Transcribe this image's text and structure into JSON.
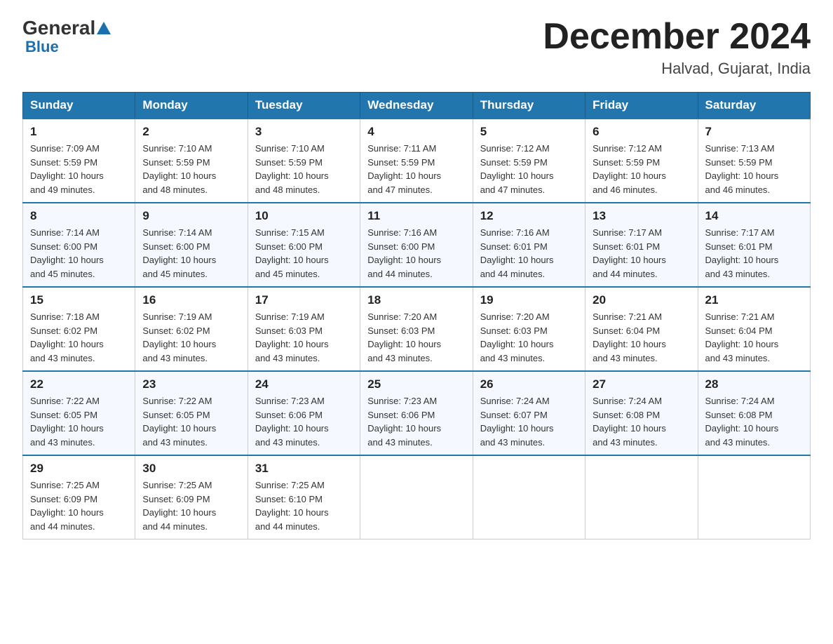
{
  "header": {
    "logo_general": "General",
    "logo_triangle": "▶",
    "logo_blue": "Blue",
    "month_title": "December 2024",
    "location": "Halvad, Gujarat, India"
  },
  "days_of_week": [
    "Sunday",
    "Monday",
    "Tuesday",
    "Wednesday",
    "Thursday",
    "Friday",
    "Saturday"
  ],
  "weeks": [
    [
      {
        "day": "1",
        "sunrise": "7:09 AM",
        "sunset": "5:59 PM",
        "daylight": "10 hours and 49 minutes."
      },
      {
        "day": "2",
        "sunrise": "7:10 AM",
        "sunset": "5:59 PM",
        "daylight": "10 hours and 48 minutes."
      },
      {
        "day": "3",
        "sunrise": "7:10 AM",
        "sunset": "5:59 PM",
        "daylight": "10 hours and 48 minutes."
      },
      {
        "day": "4",
        "sunrise": "7:11 AM",
        "sunset": "5:59 PM",
        "daylight": "10 hours and 47 minutes."
      },
      {
        "day": "5",
        "sunrise": "7:12 AM",
        "sunset": "5:59 PM",
        "daylight": "10 hours and 47 minutes."
      },
      {
        "day": "6",
        "sunrise": "7:12 AM",
        "sunset": "5:59 PM",
        "daylight": "10 hours and 46 minutes."
      },
      {
        "day": "7",
        "sunrise": "7:13 AM",
        "sunset": "5:59 PM",
        "daylight": "10 hours and 46 minutes."
      }
    ],
    [
      {
        "day": "8",
        "sunrise": "7:14 AM",
        "sunset": "6:00 PM",
        "daylight": "10 hours and 45 minutes."
      },
      {
        "day": "9",
        "sunrise": "7:14 AM",
        "sunset": "6:00 PM",
        "daylight": "10 hours and 45 minutes."
      },
      {
        "day": "10",
        "sunrise": "7:15 AM",
        "sunset": "6:00 PM",
        "daylight": "10 hours and 45 minutes."
      },
      {
        "day": "11",
        "sunrise": "7:16 AM",
        "sunset": "6:00 PM",
        "daylight": "10 hours and 44 minutes."
      },
      {
        "day": "12",
        "sunrise": "7:16 AM",
        "sunset": "6:01 PM",
        "daylight": "10 hours and 44 minutes."
      },
      {
        "day": "13",
        "sunrise": "7:17 AM",
        "sunset": "6:01 PM",
        "daylight": "10 hours and 44 minutes."
      },
      {
        "day": "14",
        "sunrise": "7:17 AM",
        "sunset": "6:01 PM",
        "daylight": "10 hours and 43 minutes."
      }
    ],
    [
      {
        "day": "15",
        "sunrise": "7:18 AM",
        "sunset": "6:02 PM",
        "daylight": "10 hours and 43 minutes."
      },
      {
        "day": "16",
        "sunrise": "7:19 AM",
        "sunset": "6:02 PM",
        "daylight": "10 hours and 43 minutes."
      },
      {
        "day": "17",
        "sunrise": "7:19 AM",
        "sunset": "6:03 PM",
        "daylight": "10 hours and 43 minutes."
      },
      {
        "day": "18",
        "sunrise": "7:20 AM",
        "sunset": "6:03 PM",
        "daylight": "10 hours and 43 minutes."
      },
      {
        "day": "19",
        "sunrise": "7:20 AM",
        "sunset": "6:03 PM",
        "daylight": "10 hours and 43 minutes."
      },
      {
        "day": "20",
        "sunrise": "7:21 AM",
        "sunset": "6:04 PM",
        "daylight": "10 hours and 43 minutes."
      },
      {
        "day": "21",
        "sunrise": "7:21 AM",
        "sunset": "6:04 PM",
        "daylight": "10 hours and 43 minutes."
      }
    ],
    [
      {
        "day": "22",
        "sunrise": "7:22 AM",
        "sunset": "6:05 PM",
        "daylight": "10 hours and 43 minutes."
      },
      {
        "day": "23",
        "sunrise": "7:22 AM",
        "sunset": "6:05 PM",
        "daylight": "10 hours and 43 minutes."
      },
      {
        "day": "24",
        "sunrise": "7:23 AM",
        "sunset": "6:06 PM",
        "daylight": "10 hours and 43 minutes."
      },
      {
        "day": "25",
        "sunrise": "7:23 AM",
        "sunset": "6:06 PM",
        "daylight": "10 hours and 43 minutes."
      },
      {
        "day": "26",
        "sunrise": "7:24 AM",
        "sunset": "6:07 PM",
        "daylight": "10 hours and 43 minutes."
      },
      {
        "day": "27",
        "sunrise": "7:24 AM",
        "sunset": "6:08 PM",
        "daylight": "10 hours and 43 minutes."
      },
      {
        "day": "28",
        "sunrise": "7:24 AM",
        "sunset": "6:08 PM",
        "daylight": "10 hours and 43 minutes."
      }
    ],
    [
      {
        "day": "29",
        "sunrise": "7:25 AM",
        "sunset": "6:09 PM",
        "daylight": "10 hours and 44 minutes."
      },
      {
        "day": "30",
        "sunrise": "7:25 AM",
        "sunset": "6:09 PM",
        "daylight": "10 hours and 44 minutes."
      },
      {
        "day": "31",
        "sunrise": "7:25 AM",
        "sunset": "6:10 PM",
        "daylight": "10 hours and 44 minutes."
      },
      null,
      null,
      null,
      null
    ]
  ],
  "labels": {
    "sunrise": "Sunrise:",
    "sunset": "Sunset:",
    "daylight": "Daylight:"
  }
}
